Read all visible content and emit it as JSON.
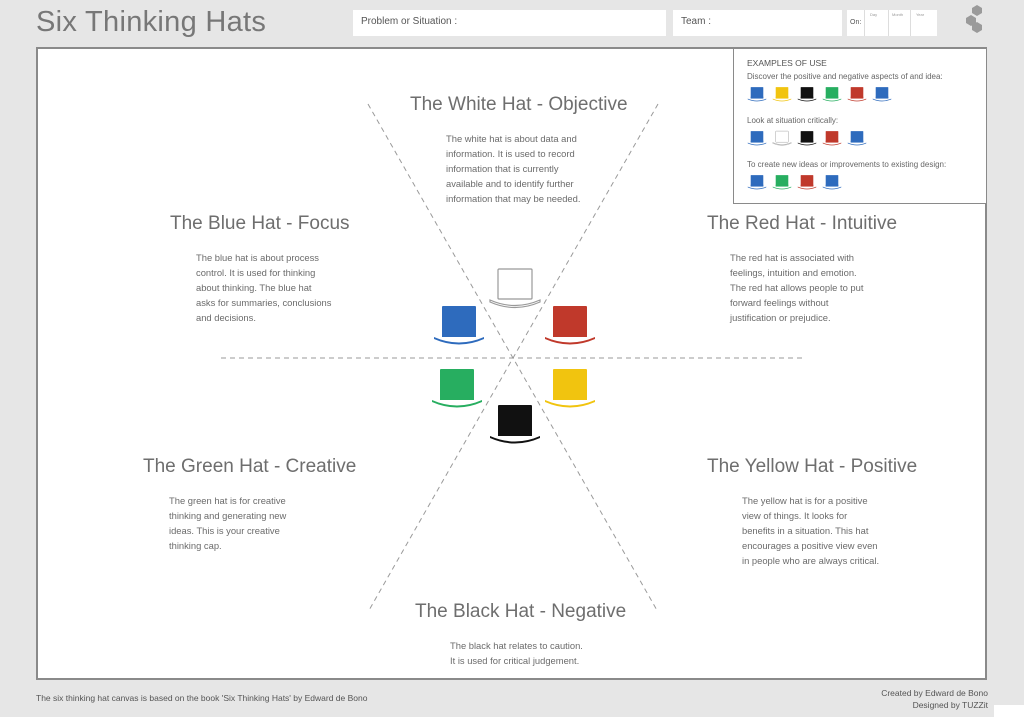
{
  "header": {
    "title": "Six Thinking Hats",
    "problem_label": "Problem or Situation :",
    "team_label": "Team :",
    "on_label": "On:",
    "date_labels": [
      "Day",
      "Month",
      "Year"
    ]
  },
  "hats": {
    "white": {
      "title": "The White Hat - Objective",
      "lines": [
        "The white hat is about data and",
        "information. It is used to record",
        "information that is currently",
        "available and to identify further",
        "information that may be needed."
      ],
      "color": "#ffffff"
    },
    "red": {
      "title": "The Red Hat - Intuitive",
      "lines": [
        "The red hat is associated with",
        "feelings, intuition and emotion.",
        "The red hat allows people to put",
        "forward feelings without",
        "justification or prejudice."
      ],
      "color": "#c0392b"
    },
    "yellow": {
      "title": "The Yellow Hat - Positive",
      "lines": [
        "The yellow hat is for a positive",
        "view of things. It looks for",
        "benefits in a situation. This hat",
        "encourages a positive view even",
        "in people who are always critical."
      ],
      "color": "#f1c40f"
    },
    "black": {
      "title": "The Black Hat - Negative",
      "lines": [
        "The black hat relates to caution.",
        "It is used for critical judgement."
      ],
      "color": "#111111"
    },
    "green": {
      "title": "The Green Hat - Creative",
      "lines": [
        "The green hat is for creative",
        "thinking and generating new",
        "ideas. This is your creative",
        "thinking cap."
      ],
      "color": "#27ae60"
    },
    "blue": {
      "title": "The Blue Hat - Focus",
      "lines": [
        "The blue hat is about process",
        "control. It is used for thinking",
        "about thinking. The blue hat",
        "asks for summaries, conclusions",
        "and decisions."
      ],
      "color": "#2e6bbd"
    }
  },
  "examples": {
    "heading": "EXAMPLES OF USE",
    "groups": [
      {
        "label": "Discover the positive and negative aspects of and idea:",
        "hats": [
          "blue",
          "yellow",
          "black",
          "green",
          "red",
          "blue"
        ]
      },
      {
        "label": "Look at  situation critically:",
        "hats": [
          "blue",
          "white",
          "black",
          "red",
          "blue"
        ]
      },
      {
        "label": "To create new ideas or improvements to existing design:",
        "hats": [
          "blue",
          "green",
          "red",
          "blue"
        ]
      }
    ]
  },
  "footer": {
    "source": "The six thinking hat canvas is based on the book 'Six Thinking Hats'  by Edward de Bono",
    "created": "Created by Edward de Bono",
    "designed": "Designed by TUZZit"
  }
}
